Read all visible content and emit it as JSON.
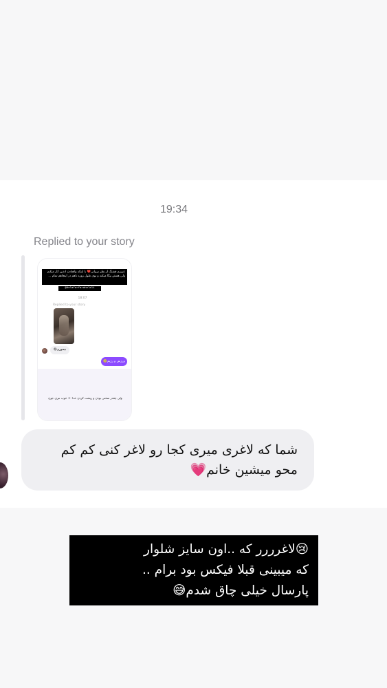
{
  "chat": {
    "timestamp": "19:34",
    "replied_label": "Replied to your story",
    "story_preview": {
      "header_text": "عزیزم قشنگ از نظر تریپاتی❤️ با اینکه واقعادن ادذین کار میکنم ولی همش بیگا میکنه و توی طول روزه ناهم در اینجاهم تمام ...",
      "username": "@delafarfaraheleli",
      "time": "18:07",
      "replied_label": "Replied to your story",
      "bubble_left": "چجوری😅",
      "bubble_right": "ورزش و رژیم🥹",
      "caption": "ولی چقدر سختی بودن و ریشت کردن خدا -> خوب نبری جون"
    },
    "message": {
      "line1": "شما که لاغری میری کجا رو لاغر کنی کم کم",
      "line2": "محو میشین خانم💗"
    }
  },
  "story_caption": {
    "line1": "😢لاغرررر که ..اون سایز شلوار",
    "line2": "که میبینی قبلا فیکس بود برام ..",
    "line3": "پارسال خیلی چاق شدم😅"
  }
}
